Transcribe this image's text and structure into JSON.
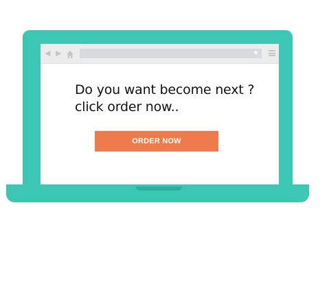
{
  "colors": {
    "laptop_body": "#3cc6b4",
    "browser_chrome": "#ececed",
    "address_bar": "#d9dadd",
    "button_background": "#ef7a4b",
    "button_text": "#ffffff"
  },
  "icons": {
    "back": "back-arrow-icon",
    "forward": "forward-arrow-icon",
    "home": "home-icon",
    "bookmark": "star-icon",
    "menu": "menu-icon"
  },
  "main": {
    "headline_line1": "Do you want become next ?",
    "headline_line2": "click order now..",
    "order_button_label": "ORDER NOW"
  }
}
